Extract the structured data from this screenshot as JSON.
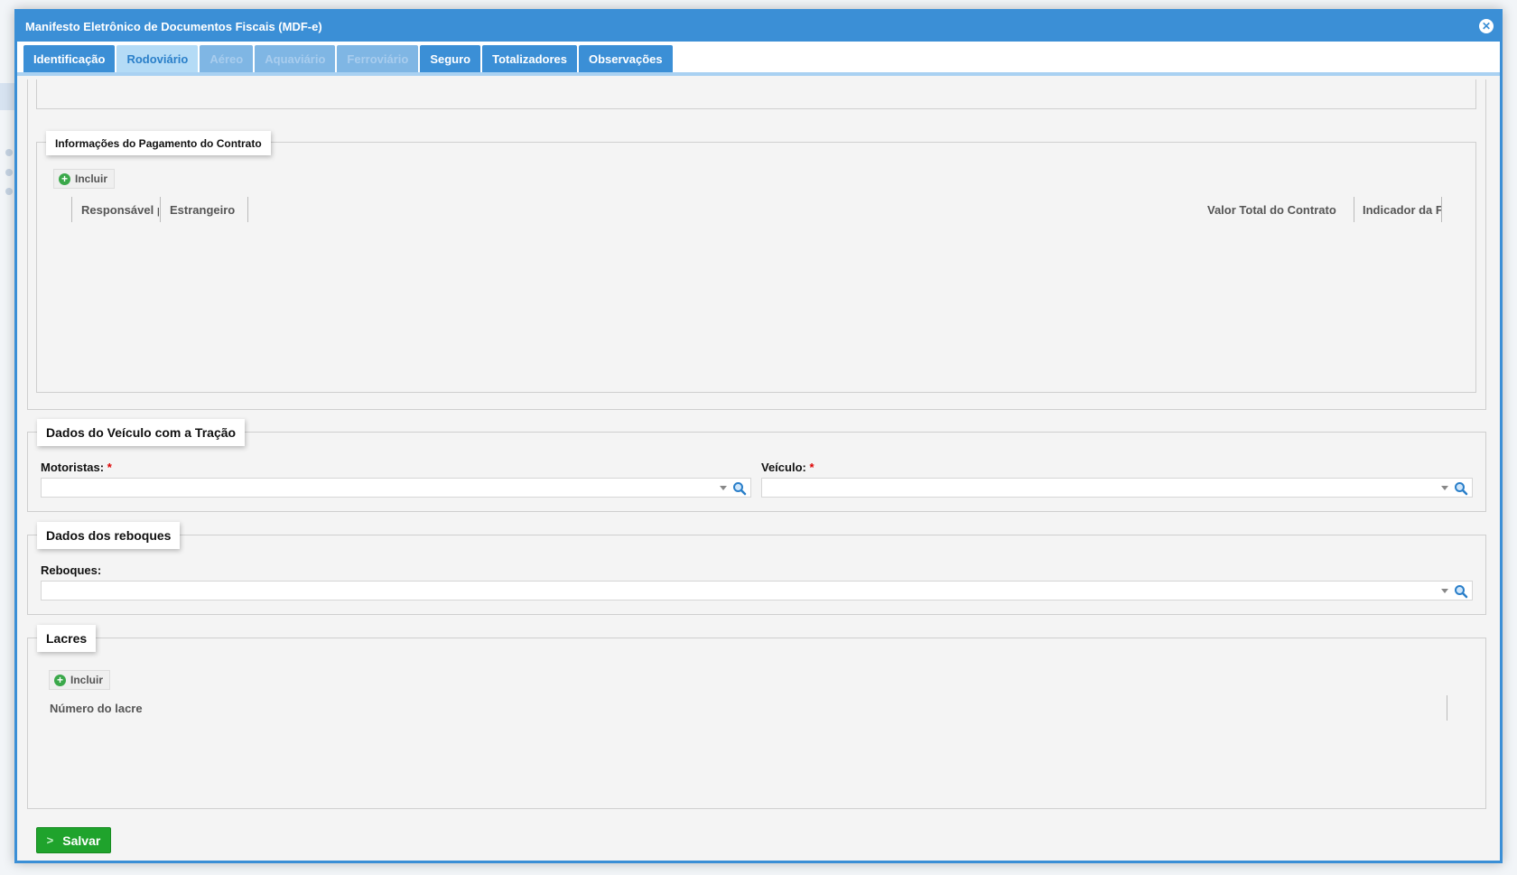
{
  "modal": {
    "title": "Manifesto Eletrônico de Documentos Fiscais (MDF-e)",
    "close_icon": "close-icon"
  },
  "tabs": [
    {
      "label": "Identificação",
      "state": "enabled"
    },
    {
      "label": "Rodoviário",
      "state": "active"
    },
    {
      "label": "Aéreo",
      "state": "disabled"
    },
    {
      "label": "Aquaviário",
      "state": "disabled"
    },
    {
      "label": "Ferroviário",
      "state": "disabled"
    },
    {
      "label": "Seguro",
      "state": "enabled"
    },
    {
      "label": "Totalizadores",
      "state": "enabled"
    },
    {
      "label": "Observações",
      "state": "enabled"
    }
  ],
  "pagamento": {
    "legend": "Informações do Pagamento do Contrato",
    "incluir_label": "Incluir",
    "columns": [
      "Responsável pelo pagamento",
      "Estrangeiro",
      "Valor Total do Contrato",
      "Indicador da Forma de Pagamento"
    ]
  },
  "veiculo_tracao": {
    "legend": "Dados do Veículo com a Tração",
    "motoristas_label": "Motoristas:",
    "veiculo_label": "Veículo:",
    "required_mark": "*"
  },
  "reboques": {
    "legend": "Dados dos reboques",
    "reboques_label": "Reboques:"
  },
  "lacres": {
    "legend": "Lacres",
    "incluir_label": "Incluir",
    "column": "Número do lacre"
  },
  "footer": {
    "save_label": "Salvar"
  },
  "colors": {
    "primary": "#3b8fd6",
    "active_tab_bg": "#b4dbf6",
    "save_green": "#1fa32c",
    "required_red": "#dd0000"
  }
}
